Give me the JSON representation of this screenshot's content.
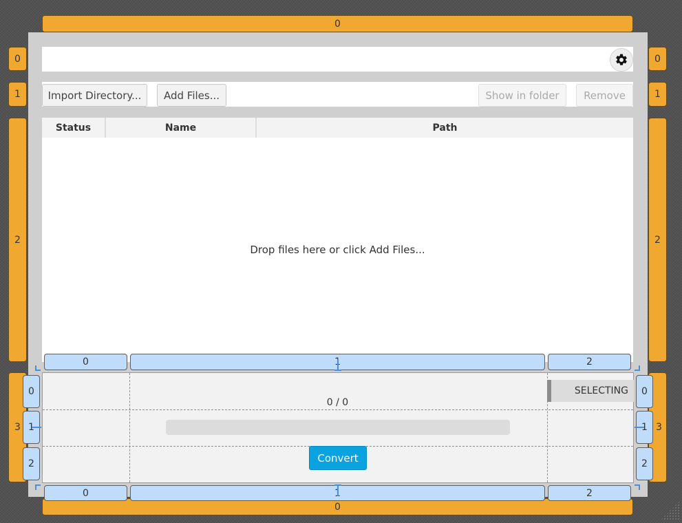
{
  "outer_grid": {
    "top_column": "0",
    "bottom_column": "0",
    "left_rows": [
      "0",
      "1",
      "2",
      "3"
    ],
    "right_rows": [
      "0",
      "1",
      "2",
      "3"
    ]
  },
  "settings": {
    "icon": "gear-icon"
  },
  "toolbar": {
    "import_directory": "Import Directory...",
    "add_files": "Add Files...",
    "show_in_folder": "Show in folder",
    "remove": "Remove"
  },
  "table": {
    "columns": [
      "Status",
      "Name",
      "Path"
    ],
    "empty_message": "Drop files here or click Add Files..."
  },
  "bottom_grid": {
    "top_columns": [
      "0",
      "1",
      "2"
    ],
    "bottom_columns": [
      "0",
      "1",
      "2"
    ],
    "left_rows": [
      "0",
      "1",
      "2"
    ],
    "right_rows": [
      "0",
      "1",
      "2"
    ]
  },
  "status": {
    "mode": "SELECTING",
    "progress_text": "0 / 0",
    "progress_value": 0
  },
  "actions": {
    "convert": "Convert"
  },
  "colors": {
    "grid_header_orange": "#f0a830",
    "grid_header_blue": "#bfdcfa",
    "convert_button": "#0aa3e0"
  }
}
